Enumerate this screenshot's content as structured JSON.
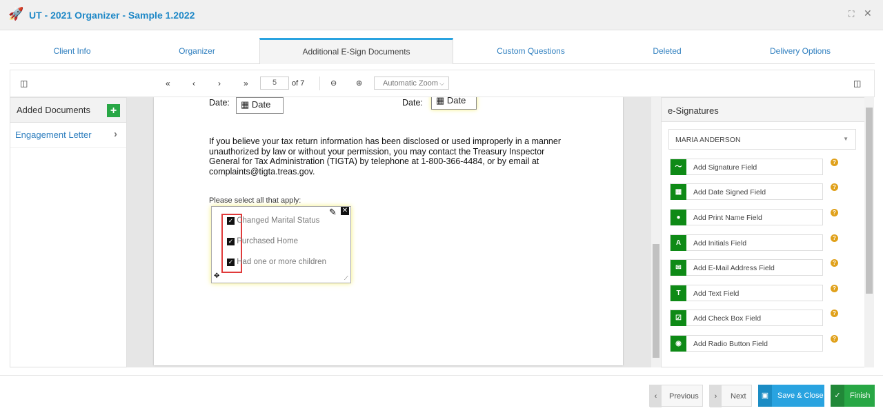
{
  "window": {
    "title": "UT - 2021 Organizer - Sample 1.2022"
  },
  "tabs": [
    "Client Info",
    "Organizer",
    "Additional E-Sign Documents",
    "Custom Questions",
    "Deleted",
    "Delivery Options"
  ],
  "toolbar": {
    "page": "5",
    "of": "of 7",
    "zoom": "Automatic Zoom"
  },
  "left": {
    "title": "Added Documents",
    "items": [
      "Engagement Letter"
    ]
  },
  "doc": {
    "date_label": "Date:",
    "date_field": "Date",
    "paragraph": [
      "If you believe your tax return information has been disclosed or used improperly in a manner",
      "unauthorized by law or without your permission, you may contact the Treasury Inspector",
      "General for Tax Administration (TIGTA) by telephone at 1-800-366-4484, or by email at",
      "complaints@tigta.treas.gov."
    ],
    "prompt": "Please select all that apply:",
    "checks": [
      "Changed Marital Status",
      "Purchased Home",
      "Had one or more children"
    ]
  },
  "right": {
    "title": "e-Signatures",
    "signer": "MARIA ANDERSON",
    "fields": [
      "Add Signature Field",
      "Add Date Signed Field",
      "Add Print Name Field",
      "Add Initials Field",
      "Add E-Mail Address Field",
      "Add Text Field",
      "Add Check Box Field",
      "Add Radio Button Field"
    ]
  },
  "footer": {
    "previous": "Previous",
    "next": "Next",
    "save": "Save & Close",
    "finish": "Finish"
  },
  "colors": {
    "accent": "#1e88c7",
    "green": "#0e8a16",
    "finish": "#28a745",
    "save": "#29a3e0"
  }
}
